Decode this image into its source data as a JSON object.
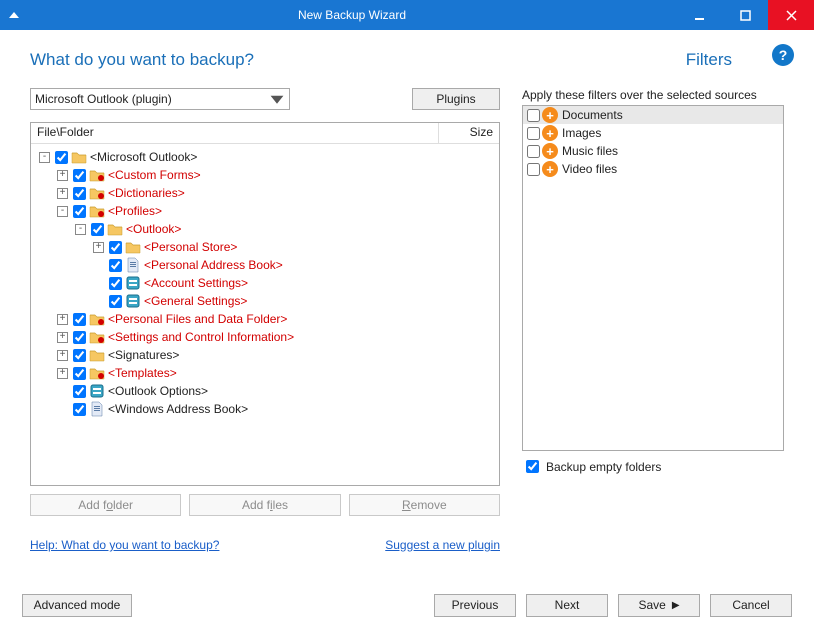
{
  "window": {
    "title": "New Backup Wizard"
  },
  "headings": {
    "left": "What do you want to backup?",
    "right": "Filters"
  },
  "help": {
    "symbol": "?"
  },
  "combo": {
    "selected": "Microsoft Outlook (plugin)"
  },
  "plugins_btn": "Plugins",
  "tree": {
    "header_left": "File\\Folder",
    "header_right": "Size",
    "nodes": [
      {
        "depth": 0,
        "pm": "-",
        "check": true,
        "icon": "folder",
        "label": "<Microsoft Outlook>",
        "red": false
      },
      {
        "depth": 1,
        "pm": "+",
        "check": true,
        "icon": "folder-red",
        "label": "<Custom Forms>",
        "red": true
      },
      {
        "depth": 1,
        "pm": "+",
        "check": true,
        "icon": "folder-red",
        "label": "<Dictionaries>",
        "red": true
      },
      {
        "depth": 1,
        "pm": "-",
        "check": true,
        "icon": "folder-red",
        "label": "<Profiles>",
        "red": true
      },
      {
        "depth": 2,
        "pm": "-",
        "check": true,
        "icon": "folder",
        "label": "<Outlook>",
        "red": true
      },
      {
        "depth": 3,
        "pm": "+",
        "check": true,
        "icon": "folder",
        "label": "<Personal Store>",
        "red": true
      },
      {
        "depth": 3,
        "pm": "",
        "check": true,
        "icon": "file",
        "label": "<Personal Address Book>",
        "red": true
      },
      {
        "depth": 3,
        "pm": "",
        "check": true,
        "icon": "reg",
        "label": "<Account Settings>",
        "red": true
      },
      {
        "depth": 3,
        "pm": "",
        "check": true,
        "icon": "reg",
        "label": "<General Settings>",
        "red": true
      },
      {
        "depth": 1,
        "pm": "+",
        "check": true,
        "icon": "folder-red",
        "label": "<Personal Files and Data Folder>",
        "red": true
      },
      {
        "depth": 1,
        "pm": "+",
        "check": true,
        "icon": "folder-red",
        "label": "<Settings and Control Information>",
        "red": true
      },
      {
        "depth": 1,
        "pm": "+",
        "check": true,
        "icon": "folder",
        "label": "<Signatures>",
        "red": false
      },
      {
        "depth": 1,
        "pm": "+",
        "check": true,
        "icon": "folder-red",
        "label": "<Templates>",
        "red": true
      },
      {
        "depth": 1,
        "pm": "",
        "check": true,
        "icon": "reg",
        "label": "<Outlook Options>",
        "red": false
      },
      {
        "depth": 1,
        "pm": "",
        "check": true,
        "icon": "file",
        "label": "<Windows Address Book>",
        "red": false
      }
    ]
  },
  "left_buttons": {
    "add_folder_pre": "Add f",
    "add_folder_u": "o",
    "add_folder_post": "lder",
    "add_files_pre": "Add f",
    "add_files_u": "i",
    "add_files_post": "les",
    "remove_pre": "",
    "remove_u": "R",
    "remove_post": "emove"
  },
  "links": {
    "help": "Help: What do you want to backup?",
    "suggest": "Suggest a new plugin"
  },
  "filters": {
    "desc": "Apply these filters over the selected sources",
    "items": [
      {
        "label": "Documents",
        "selected": true
      },
      {
        "label": "Images",
        "selected": false
      },
      {
        "label": "Music files",
        "selected": false
      },
      {
        "label": "Video files",
        "selected": false
      }
    ],
    "backup_empty": {
      "checked": true,
      "label": "Backup empty folders"
    }
  },
  "footer": {
    "advanced": "Advanced mode",
    "previous": "Previous",
    "next": "Next",
    "save": "Save",
    "cancel": "Cancel"
  }
}
